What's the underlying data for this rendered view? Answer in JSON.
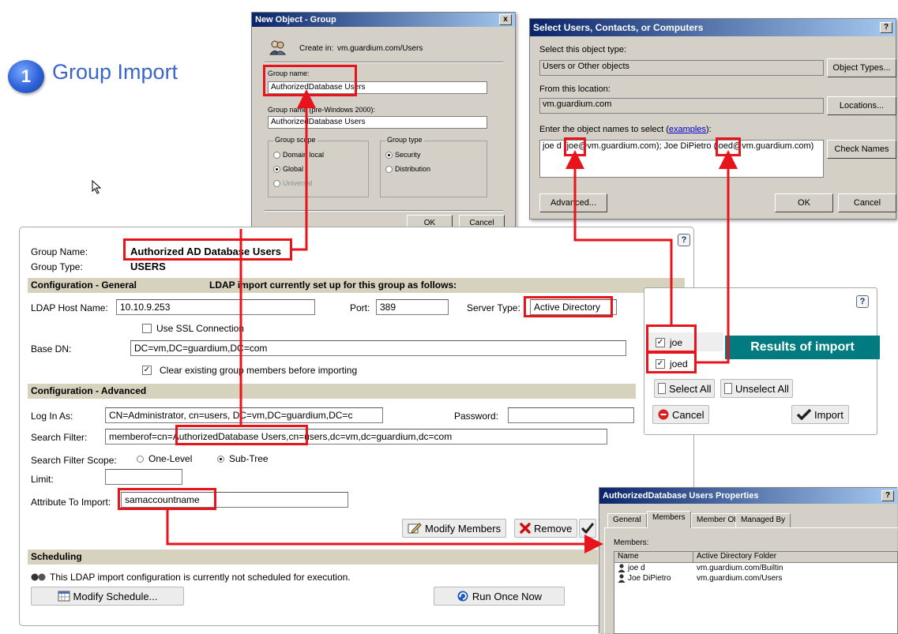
{
  "slide": {
    "step_number": "1",
    "title": "Group Import"
  },
  "new_object_dialog": {
    "title": "New Object - Group",
    "create_in_label": "Create in:",
    "create_in_value": "vm.guardium.com/Users",
    "group_name_label": "Group name:",
    "group_name_value": "AuthorizedDatabase Users",
    "group_name_pre2000_label": "Group name (pre-Windows 2000):",
    "group_name_pre2000_value": "AuthorizedDatabase Users",
    "group_scope_label": "Group scope",
    "scope_options": [
      "Domain local",
      "Global",
      "Universal"
    ],
    "scope_selected": "Global",
    "group_type_label": "Group type",
    "type_options": [
      "Security",
      "Distribution"
    ],
    "type_selected": "Security",
    "ok_label": "OK",
    "cancel_label": "Cancel",
    "close_glyph": "x"
  },
  "select_users_dialog": {
    "title": "Select Users, Contacts, or Computers",
    "help_glyph": "?",
    "object_type_label": "Select this object type:",
    "object_type_value": "Users or Other objects",
    "object_types_button": "Object Types...",
    "location_label": "From this location:",
    "location_value": "vm.guardium.com",
    "locations_button": "Locations...",
    "names_label": "Enter the object names to select (",
    "names_link": "examples",
    "names_label_end": "):",
    "names_value": "joe d (joe@vm.guardium.com); Joe DiPietro (joed@vm.guardium.com)",
    "check_names_button": "Check Names",
    "advanced_button": "Advanced...",
    "ok_label": "OK",
    "cancel_label": "Cancel"
  },
  "ldap_form": {
    "help_glyph": "?",
    "group_name_label": "Group Name:",
    "group_name_value": "Authorized AD Database Users",
    "group_type_label": "Group Type:",
    "group_type_value": "USERS",
    "config_general_label": "Configuration - General",
    "ldap_status": "LDAP import currently set up for this group as follows:",
    "ldap_host_label": "LDAP Host Name:",
    "ldap_host_value": "10.10.9.253",
    "port_label": "Port:",
    "port_value": "389",
    "server_type_label": "Server Type:",
    "server_type_value": "Active Directory",
    "use_ssl_label": "Use SSL Connection",
    "use_ssl_checked": false,
    "base_dn_label": "Base DN:",
    "base_dn_value": "DC=vm,DC=guardium,DC=com",
    "clear_existing_label": "Clear existing group members before importing",
    "clear_existing_checked": true,
    "config_advanced_label": "Configuration - Advanced",
    "login_label": "Log In As:",
    "login_value": "CN=Administrator, cn=users, DC=vm,DC=guardium,DC=c",
    "password_label": "Password:",
    "password_value": "",
    "search_filter_label": "Search Filter:",
    "search_filter_value": "memberof=cn=AuthorizedDatabase Users,cn=users,dc=vm,dc=guardium,dc=com",
    "scope_label": "Search Filter Scope:",
    "scope_options": [
      "One-Level",
      "Sub-Tree"
    ],
    "scope_selected": "Sub-Tree",
    "limit_label": "Limit:",
    "limit_value": "",
    "attribute_label": "Attribute To Import:",
    "attribute_value": "samaccountname",
    "modify_members_button": "Modify Members",
    "remove_button": "Remove",
    "scheduling_label": "Scheduling",
    "schedule_status": "This LDAP import configuration is currently not scheduled for execution.",
    "modify_schedule_button": "Modify Schedule...",
    "run_once_button": "Run Once Now"
  },
  "import_results": {
    "help_glyph": "?",
    "items": [
      {
        "label": "joe",
        "checked": true
      },
      {
        "label": "joed",
        "checked": true
      }
    ],
    "banner": "Results of import",
    "select_all_button": "Select All",
    "unselect_all_button": "Unselect All",
    "cancel_button": "Cancel",
    "import_button": "Import"
  },
  "properties_window": {
    "title": "AuthorizedDatabase Users Properties",
    "help_glyph": "?",
    "tabs": [
      "General",
      "Members",
      "Member Of",
      "Managed By"
    ],
    "active_tab": "Members",
    "members_label": "Members:",
    "columns": [
      "Name",
      "Active Directory Folder"
    ],
    "rows": [
      [
        "joe d",
        "vm.guardium.com/Builtin"
      ],
      [
        "Joe DiPietro",
        "vm.guardium.com/Users"
      ]
    ]
  },
  "colors": {
    "annotation_red": "#e8141b",
    "section_bar": "#d6d2bd",
    "results_banner": "#007c80",
    "title_blue": "#3a66c9"
  }
}
